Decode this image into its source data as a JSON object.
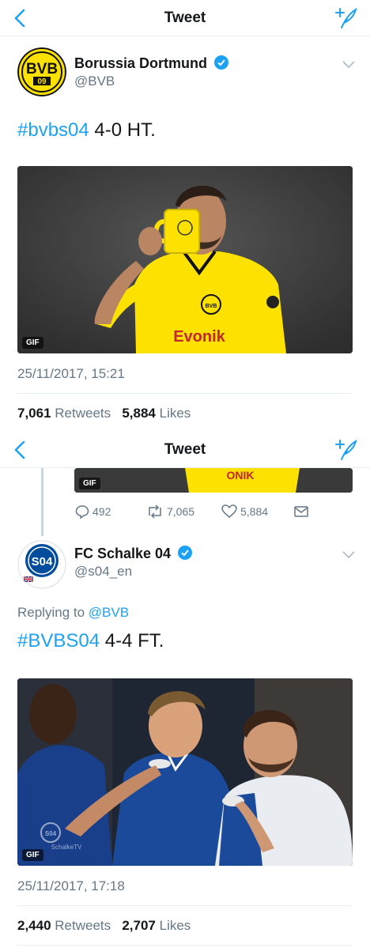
{
  "nav1": {
    "title": "Tweet"
  },
  "tweet1": {
    "name": "Borussia Dortmund",
    "handle": "@BVB",
    "avatar_text": "BVB 09",
    "hashtag": "#bvbs04",
    "text": " 4-0 HT.",
    "gif_label": "GIF",
    "timestamp": "25/11/2017, 15:21",
    "retweets_count": "7,061",
    "retweets_label": "Retweets",
    "likes_count": "5,884",
    "likes_label": "Likes",
    "media_jersey_text": "Evonik"
  },
  "nav2": {
    "title": "Tweet"
  },
  "quoted": {
    "gif_label": "GIF",
    "replies": "492",
    "retweets": "7,065",
    "likes": "5,884"
  },
  "tweet2": {
    "name": "FC Schalke 04",
    "handle": "@s04_en",
    "avatar_text": "S04",
    "replying_prefix": "Replying to",
    "replying_to": "@BVB",
    "hashtag": "#BVBS04",
    "text": " 4-4 FT.",
    "gif_label": "GIF",
    "timestamp": "25/11/2017, 17:18",
    "retweets_count": "2,440",
    "retweets_label": "Retweets",
    "likes_count": "2,707",
    "likes_label": "Likes",
    "media_watermark": "SchalkeTV"
  },
  "colors": {
    "accent": "#1da1f2",
    "bvb_yellow": "#fde100",
    "schalke_blue": "#004d9d",
    "muted": "#657786"
  }
}
